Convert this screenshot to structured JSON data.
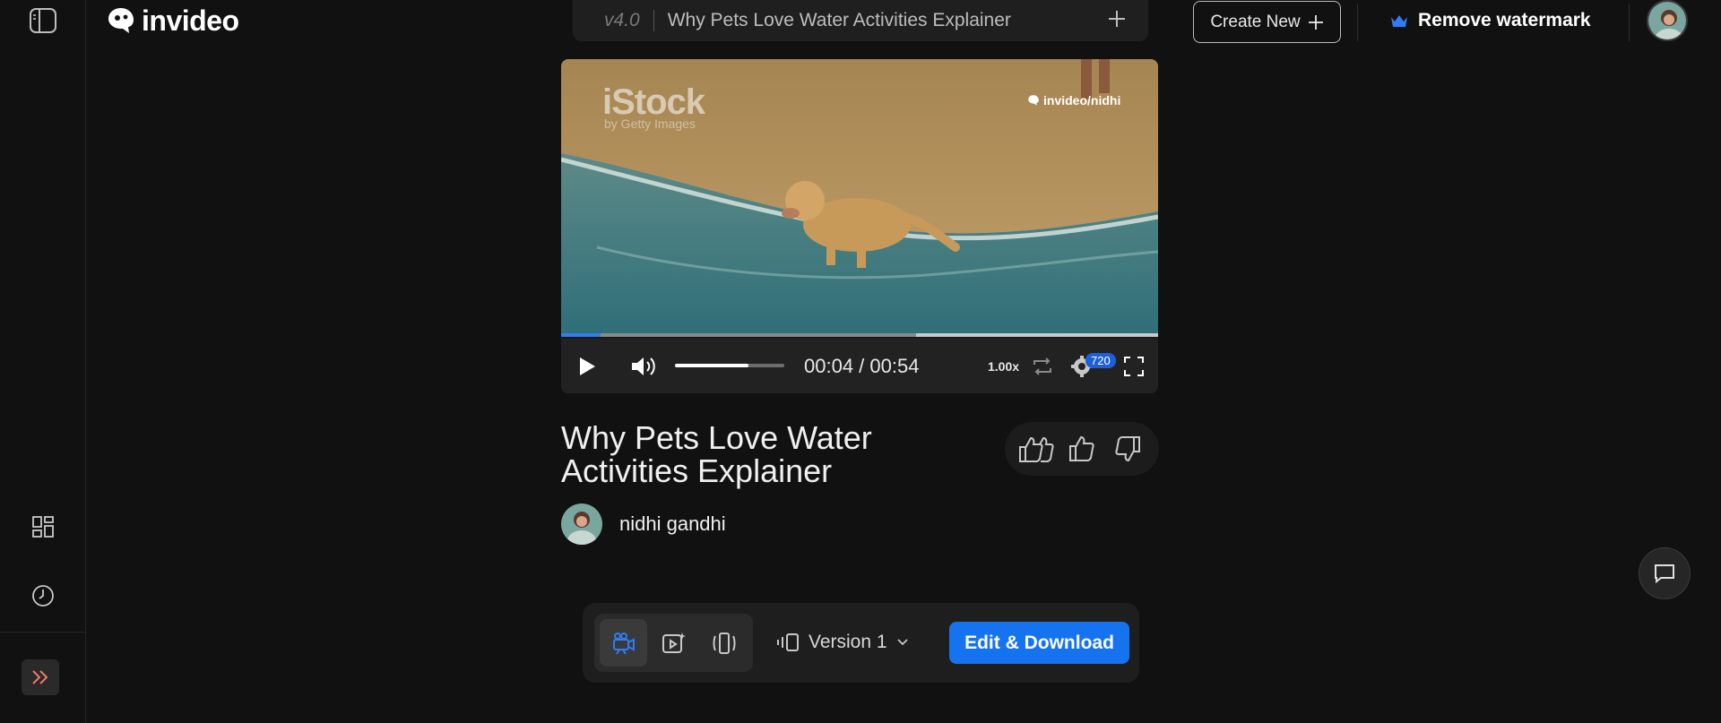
{
  "brand": {
    "name": "invideo"
  },
  "header": {
    "version": "v4.0",
    "project_title": "Why Pets Love Water Activities Explainer",
    "create_new_label": "Create New",
    "remove_watermark_label": "Remove watermark",
    "accent_color": "#1573f0"
  },
  "player": {
    "stock_watermark": "iStock",
    "stock_watermark_sub": "by Getty Images",
    "creator_watermark": "invideo/nidhi",
    "time_display": "00:04 / 00:54",
    "progress_fraction": 0.066,
    "volume_fraction": 0.67,
    "speed": "1.00x",
    "quality_badge": "720"
  },
  "video": {
    "title": "Why Pets Love Water Activities Explainer",
    "author": "nidhi gandhi"
  },
  "toolbar": {
    "version_label": "Version 1",
    "edit_download_label": "Edit & Download"
  }
}
